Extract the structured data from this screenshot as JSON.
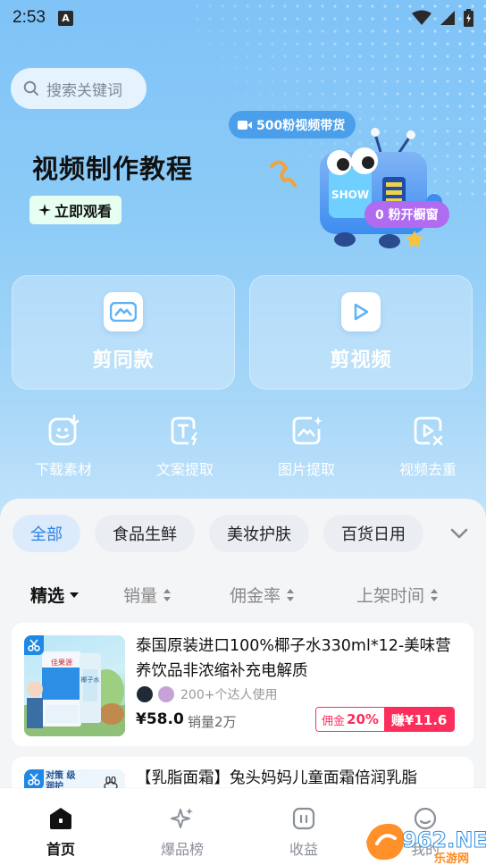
{
  "status_bar": {
    "time": "2:53",
    "notif_letter": "A"
  },
  "search": {
    "placeholder": "搜索关键词"
  },
  "banner": {
    "title": "视频制作教程",
    "watch_label": "立即观看",
    "pill_top": "500粉视频带货",
    "pill_bottom": "0 粉开橱窗",
    "mascot_screen_text": "SHOW"
  },
  "main_actions": [
    {
      "label": "剪同款",
      "icon": "mountain-icon"
    },
    {
      "label": "剪视频",
      "icon": "play-icon"
    }
  ],
  "tools": [
    {
      "label": "下载素材",
      "icon": "download-material-icon"
    },
    {
      "label": "文案提取",
      "icon": "text-extract-icon"
    },
    {
      "label": "图片提取",
      "icon": "image-extract-icon"
    },
    {
      "label": "视频去重",
      "icon": "video-dedupe-icon"
    }
  ],
  "categories": [
    "全部",
    "食品生鲜",
    "美妆护肤",
    "百货日用"
  ],
  "sorts": [
    "精选",
    "销量",
    "佣金率",
    "上架时间"
  ],
  "products": [
    {
      "title": "泰国原装进口100%椰子水330ml*12-美味营养饮品非浓缩补充电解质",
      "users": "200+个达人使用",
      "price": "¥58.0",
      "sales": "销量2万",
      "commission_label": "佣金",
      "commission_rate": "20%",
      "earn": "赚¥11.6",
      "package_brand": "佳果源",
      "package_name": "椰子水"
    },
    {
      "title": "【乳脂面霜】兔头妈妈儿童面霜倍润乳脂",
      "thumb_text": "对策 级润护"
    }
  ],
  "tabbar": [
    {
      "label": "首页",
      "icon": "home-icon",
      "active": true
    },
    {
      "label": "爆品榜",
      "icon": "sparkle-icon",
      "active": false
    },
    {
      "label": "收益",
      "icon": "wallet-icon",
      "active": false
    },
    {
      "label": "我的",
      "icon": "profile-icon",
      "active": false
    }
  ],
  "watermark": {
    "main": "962.NET",
    "sub": "乐游网"
  },
  "colors": {
    "accent": "#2a82e4",
    "red": "#fd2d5b",
    "hero": "#8ccbf7"
  }
}
